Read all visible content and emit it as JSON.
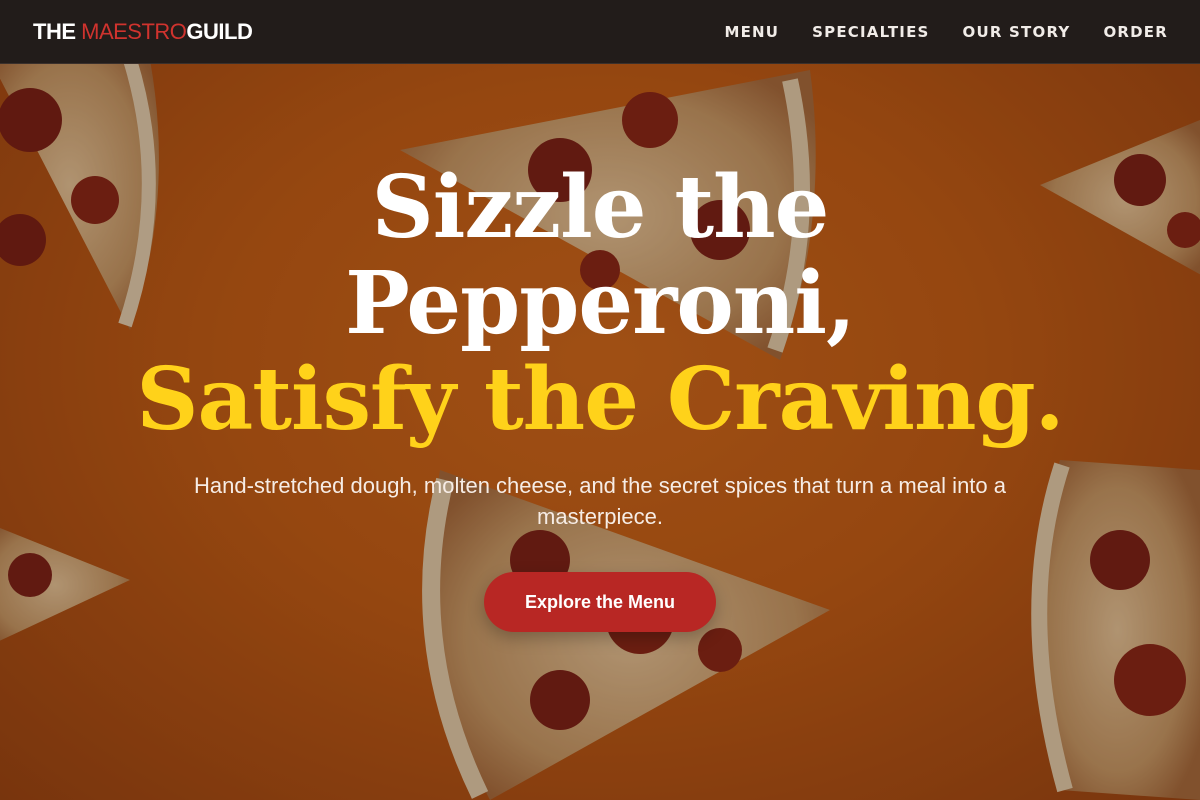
{
  "brand": {
    "prefix": "THE",
    "accent": "MAESTRO",
    "suffix": "GUILD"
  },
  "nav": {
    "items": [
      "MENU",
      "SPECIALTIES",
      "OUR STORY",
      "ORDER"
    ]
  },
  "hero": {
    "headline_line1": "Sizzle the",
    "headline_line2": "Pepperoni,",
    "headline_line3": "Satisfy the Craving.",
    "subtitle": "Hand-stretched dough, molten cheese, and the secret spices that turn a meal into a masterpiece.",
    "cta_label": "Explore the Menu",
    "background_image": "pizza-slices-on-orange"
  },
  "colors": {
    "nav_bg": "#221c1a",
    "brand_accent": "#d0332e",
    "headline_gold": "#ffd21a",
    "cta_bg": "#b82724",
    "hero_bg": "#c45d14"
  }
}
